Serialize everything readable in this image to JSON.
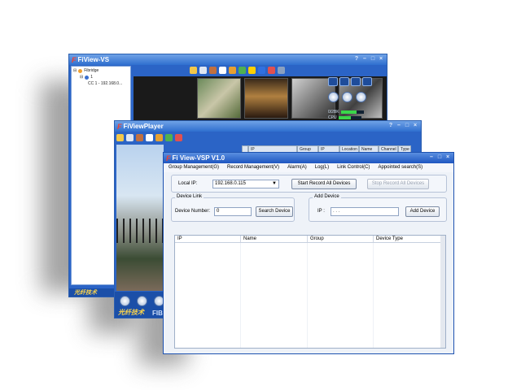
{
  "windows": {
    "vs": {
      "title": "FiView-VS",
      "title_logo": "F",
      "tree": {
        "root": "Fibridge",
        "node": "1",
        "device": "CC 1 - 192.168.0..."
      },
      "meter_labels": [
        "0/2BK",
        "CPU"
      ],
      "meter_levels": [
        0.7,
        0.55
      ],
      "footer_brand": "光纤技术"
    },
    "player": {
      "title": "FiViewPlayer",
      "title_logo": "F",
      "columns": [
        "IP",
        "Group",
        "IP",
        "Location",
        "Name",
        "Channel",
        "Type"
      ],
      "brand_cn": "光纤技术",
      "brand_en": "FIB"
    },
    "vsp": {
      "title": "Fi View-VSP  V1.0",
      "title_logo": "F",
      "menu": [
        "Group Management(G)",
        "Record Management(V)",
        "Alarm(A)",
        "Log(L)",
        "Link Control(C)",
        "Appointed search(S)"
      ],
      "local_ip_label": "Local IP:",
      "local_ip_value": "192.168.0.115",
      "start_record": "Start Record All Devices",
      "stop_record": "Stop Record All Devices",
      "device_link_title": "Device Link",
      "device_number_label": "Device Number:",
      "device_number_value": "0",
      "search_device": "Search Device",
      "add_device_title": "Add Device",
      "ip_label": "IP :",
      "ip_value": ".          .          .",
      "add_device_button": "Add Device",
      "table_headers": [
        "IP",
        "Name",
        "Group",
        "Device Type"
      ]
    }
  },
  "colors": {
    "title_gradient": "#2f6fcf",
    "accent": "#1e56c0",
    "brand_yellow": "#ffd64a"
  }
}
